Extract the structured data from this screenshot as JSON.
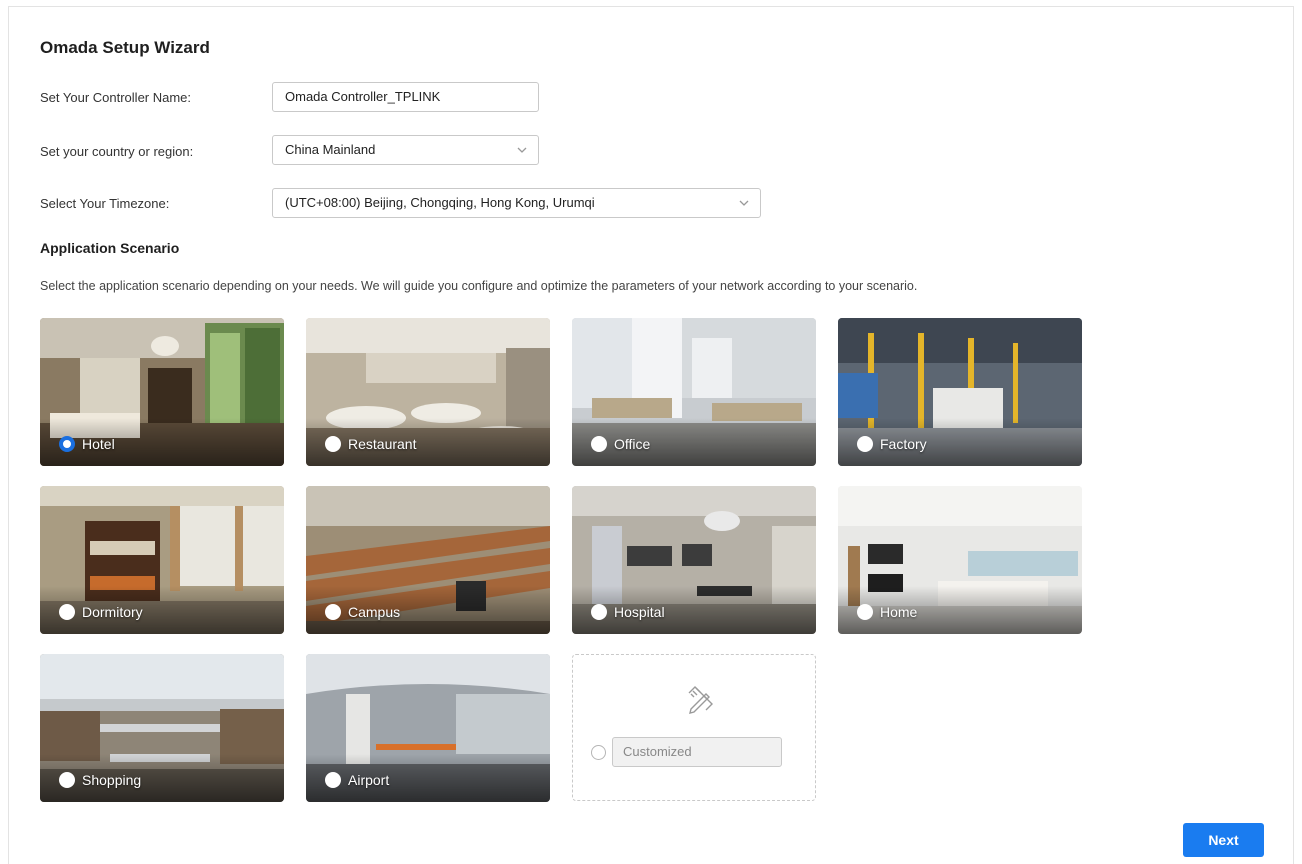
{
  "wizard": {
    "title": "Omada Setup Wizard"
  },
  "form": {
    "controller_name": {
      "label": "Set Your Controller Name:",
      "value": "Omada Controller_TPLINK"
    },
    "country": {
      "label": "Set your country or region:",
      "value": "China Mainland"
    },
    "timezone": {
      "label": "Select Your Timezone:",
      "value": "(UTC+08:00) Beijing, Chongqing, Hong Kong, Urumqi"
    }
  },
  "scenario": {
    "heading": "Application Scenario",
    "description": "Select the application scenario depending on your needs. We will guide you configure and optimize the parameters of your network according to your scenario.",
    "options": [
      {
        "label": "Hotel",
        "selected": true
      },
      {
        "label": "Restaurant",
        "selected": false
      },
      {
        "label": "Office",
        "selected": false
      },
      {
        "label": "Factory",
        "selected": false
      },
      {
        "label": "Dormitory",
        "selected": false
      },
      {
        "label": "Campus",
        "selected": false
      },
      {
        "label": "Hospital",
        "selected": false
      },
      {
        "label": "Home",
        "selected": false
      },
      {
        "label": "Shopping",
        "selected": false
      },
      {
        "label": "Airport",
        "selected": false
      }
    ],
    "customized": {
      "placeholder": "Customized",
      "icon": "edit-tools-icon"
    }
  },
  "actions": {
    "next_label": "Next"
  },
  "colors": {
    "accent": "#1a7cf0",
    "radio_selected": "#1a6fe0"
  }
}
